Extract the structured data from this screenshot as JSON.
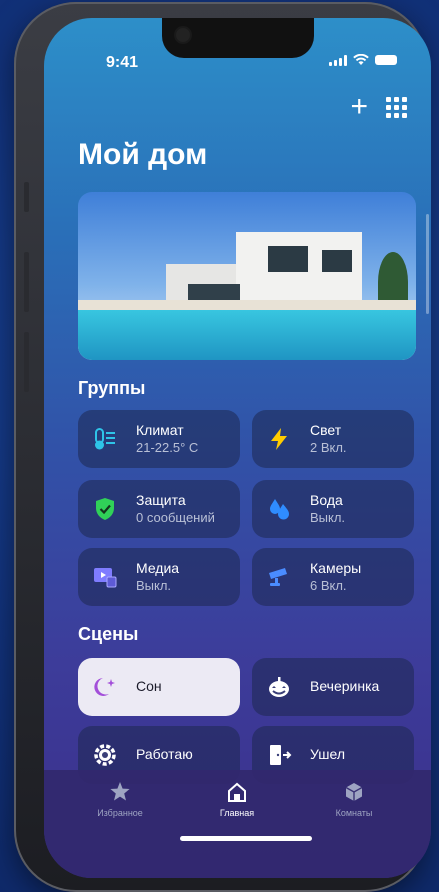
{
  "status": {
    "time": "9:41"
  },
  "page": {
    "title": "Мой дом"
  },
  "groups": {
    "heading": "Группы",
    "items": [
      {
        "name": "Климат",
        "sub": "21-22.5° C",
        "icon": "thermometer-icon",
        "color": "#2ec4e8"
      },
      {
        "name": "Свет",
        "sub": "2 Вкл.",
        "icon": "lightning-icon",
        "color": "#ffcc00"
      },
      {
        "name": "Защита",
        "sub": "0 сообщений",
        "icon": "shield-check-icon",
        "color": "#30d158"
      },
      {
        "name": "Вода",
        "sub": "Выкл.",
        "icon": "water-drops-icon",
        "color": "#2f8cff"
      },
      {
        "name": "Медиа",
        "sub": "Выкл.",
        "icon": "media-screen-icon",
        "color": "#7f7cff"
      },
      {
        "name": "Камеры",
        "sub": "6 Вкл.",
        "icon": "security-camera-icon",
        "color": "#4a8cff"
      }
    ]
  },
  "scenes": {
    "heading": "Сцены",
    "items": [
      {
        "name": "Сон",
        "icon": "moon-stars-icon",
        "active": true
      },
      {
        "name": "Вечеринка",
        "icon": "pumpkin-icon",
        "active": false
      },
      {
        "name": "Работаю",
        "icon": "gear-icon",
        "active": false
      },
      {
        "name": "Ушел",
        "icon": "door-exit-icon",
        "active": false
      }
    ]
  },
  "tabs": [
    {
      "label": "Избранное",
      "icon": "star-icon",
      "active": false
    },
    {
      "label": "Главная",
      "icon": "house-icon",
      "active": true
    },
    {
      "label": "Комнаты",
      "icon": "cube-icon",
      "active": false
    }
  ]
}
